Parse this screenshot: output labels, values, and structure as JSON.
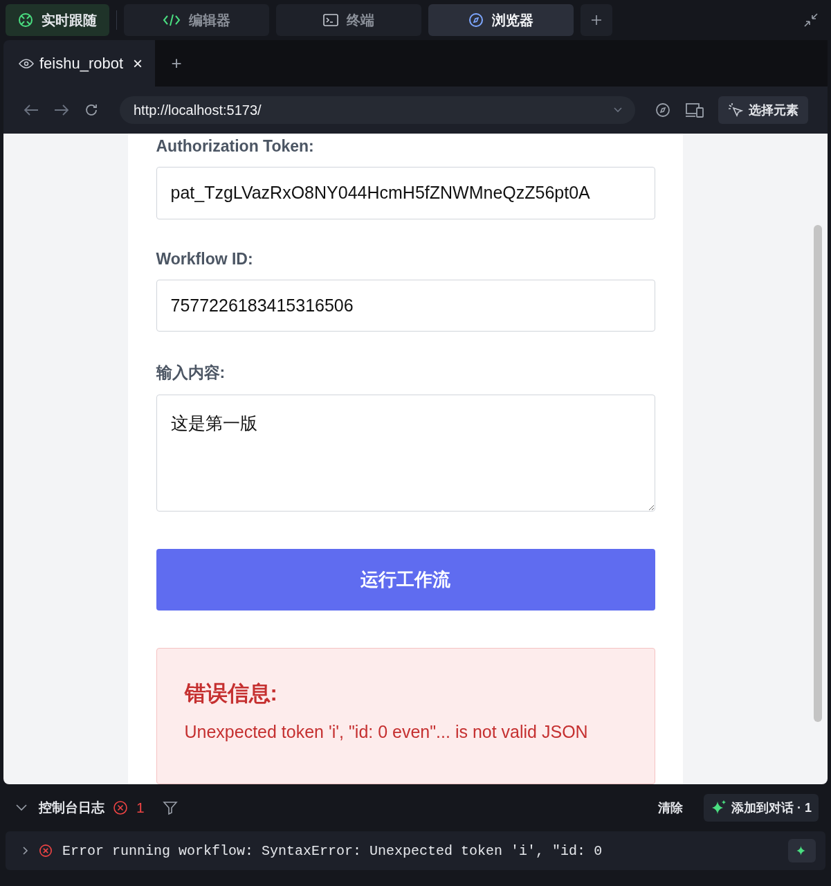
{
  "top_tabs": [
    {
      "label": "实时跟随",
      "kind": "follow",
      "selected": false
    },
    {
      "label": "编辑器",
      "kind": "editor",
      "selected": false
    },
    {
      "label": "终端",
      "kind": "terminal",
      "selected": false
    },
    {
      "label": "浏览器",
      "kind": "browser",
      "selected": true
    }
  ],
  "browser_tabs": [
    {
      "label": "feishu_robot",
      "close": "×",
      "selected": true
    }
  ],
  "new_tab": "+",
  "address_bar": {
    "url": "http://localhost:5173/"
  },
  "select_element_button": "选择元素",
  "form": {
    "fields": [
      {
        "label": "Authorization Token:",
        "kind": "input",
        "value": "pat_TzgLVazRxO8NY044HcmH5fZNWMneQzZ56pt0A"
      },
      {
        "label": "Workflow ID:",
        "kind": "input",
        "value": "7577226183415316506"
      },
      {
        "label": "输入内容:",
        "kind": "textarea",
        "value": "这是第一版"
      }
    ],
    "run_button": "运行工作流",
    "error": {
      "title": "错误信息:",
      "message": "Unexpected token 'i', \"id: 0 even\"... is not valid JSON"
    }
  },
  "console": {
    "title": "控制台日志",
    "error_count": "1",
    "clear_button": "清除",
    "add_button": "添加到对话 · 1",
    "entries": [
      {
        "kind": "error",
        "text": "Error running workflow: SyntaxError: Unexpected token 'i', \"id: 0"
      }
    ]
  }
}
